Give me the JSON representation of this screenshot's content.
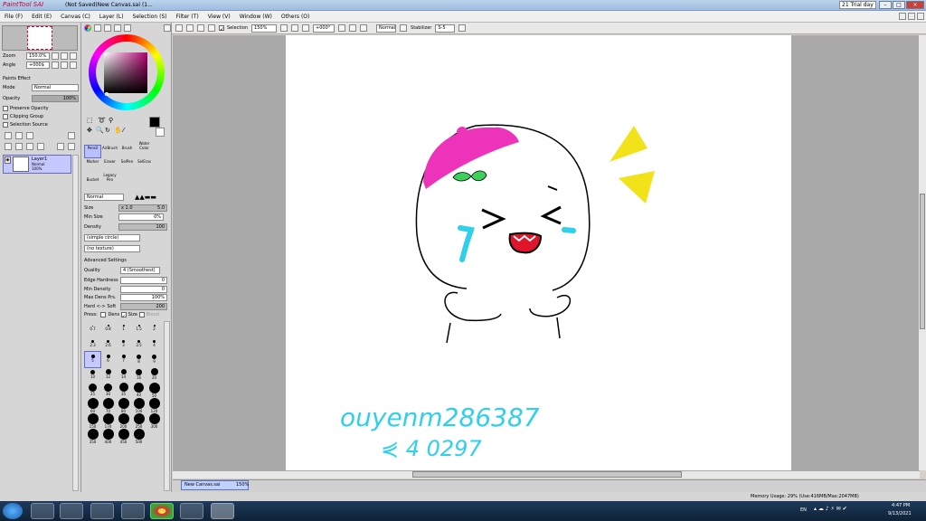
{
  "title": {
    "app": "PaintTool SAI",
    "doc": "(Not Saved)New Canvas.sai (1...",
    "trial": "21 Trial day"
  },
  "menu": [
    "File (F)",
    "Edit (E)",
    "Canvas (C)",
    "Layer (L)",
    "Selection (S)",
    "Filter (T)",
    "View (V)",
    "Window (W)",
    "Others (O)"
  ],
  "toolbar": {
    "selection_label": "Selection",
    "zoom": "150%",
    "angle": "+000°",
    "mode": "Normal",
    "stabilizer_label": "Stabilizer",
    "stabilizer_value": "S-5"
  },
  "navigator": {
    "zoom_label": "Zoom",
    "zoom_value": "150.0%",
    "angle_label": "Angle",
    "angle_value": "+000$"
  },
  "layer_panel": {
    "effect": "Paints Effect",
    "mode_label": "Mode",
    "mode_value": "Normal",
    "opacity_label": "Opacity",
    "opacity_value": "100%",
    "options": [
      "Preserve Opacity",
      "Clipping Group",
      "Selection Source"
    ],
    "layer": {
      "name": "Layer1",
      "mode": "Normal",
      "opacity": "100%"
    }
  },
  "tools": [
    "Pencil",
    "AirBrush",
    "Brush",
    "Water Color",
    "Marker",
    "Eraser",
    "SelPen",
    "SelEras",
    "Bucket",
    "Legacy Pen"
  ],
  "brush": {
    "blend": "Normal",
    "size_label": "Size",
    "size_mult": "x 1.0",
    "size_value": "5.0",
    "min_size_label": "Min Size",
    "min_size_value": "0%",
    "density_label": "Density",
    "density_value": "100",
    "shape": "(simple circle)",
    "texture": "(no texture)",
    "advanced": "Advanced Settings",
    "quality_label": "Quality",
    "quality_value": "4 (Smoothest)",
    "edge_label": "Edge Hardness",
    "edge_value": "0",
    "min_density_label": "Min Density",
    "min_density_value": "0",
    "max_dens_label": "Max Dens Prs.",
    "max_dens_value": "100%",
    "hard_soft_label": "Hard <-> Soft",
    "hard_soft_value": "200",
    "press_label": "Press:",
    "press_dens": "Dens",
    "press_size": "Size",
    "press_blend": "Blend"
  },
  "brush_sizes": [
    "0.7",
    "0.8",
    "1",
    "1.5",
    "2",
    "2.3",
    "2.6",
    "3",
    "3.5",
    "4",
    "5",
    "6",
    "7",
    "8",
    "9",
    "10",
    "12",
    "14",
    "16",
    "20",
    "25",
    "30",
    "35",
    "40",
    "50",
    "60",
    "70",
    "80",
    "100",
    "120",
    "150",
    "170",
    "200",
    "250",
    "300",
    "350",
    "400",
    "450",
    "500"
  ],
  "canvas_text": {
    "line1": "ouyenm286387",
    "line2": "⋞ 4 0297"
  },
  "doc_tab": {
    "name": "New Canvas.sai",
    "zoom": "150%"
  },
  "status": {
    "memory": "Memory Usage: 29% (Use:416MB/Max:2047MB)"
  },
  "clock": {
    "time": "4:47 PM",
    "date": "9/13/2021",
    "lang": "EN"
  },
  "colors": {
    "pink": "#ee33bb",
    "yellow": "#f2e21a",
    "blue": "#2fd0ea",
    "green": "#3ccf5a",
    "red": "#e0142a"
  }
}
